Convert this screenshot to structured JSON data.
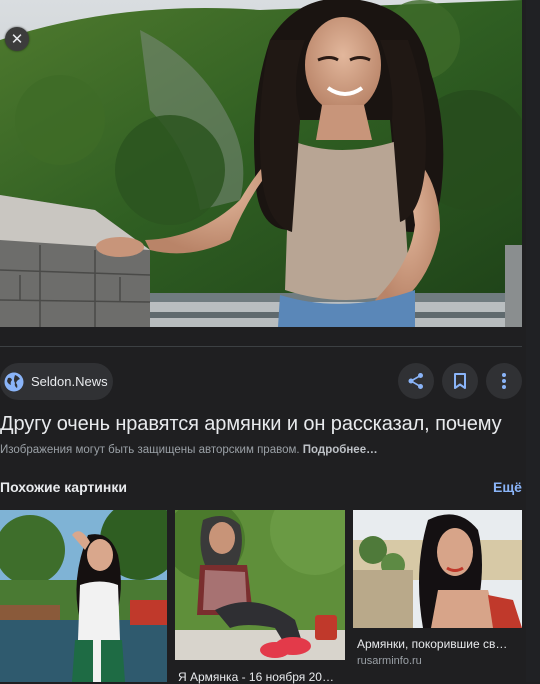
{
  "viewer": {
    "close_symbol": "✕",
    "source": {
      "name": "Seldon.News",
      "icon": "globe-icon"
    },
    "actions": [
      {
        "name": "share",
        "icon": "share-icon"
      },
      {
        "name": "save",
        "icon": "bookmark-icon"
      },
      {
        "name": "more",
        "icon": "more-vert-icon"
      }
    ],
    "title": "Другу очень нравятся армянки и он рассказал, почему",
    "copyright_notice": "Изображения могут быть защищены авторским правом.",
    "details_link": "Подробнее…"
  },
  "similar": {
    "heading": "Похожие картинки",
    "more_label": "Ещё",
    "items": [
      {
        "caption": "",
        "source": ""
      },
      {
        "caption": "Я Армянка - 16 ноября 20…",
        "source": ""
      },
      {
        "caption": "Армянки, покорившие св…",
        "source": "rusarminfo.ru"
      }
    ]
  },
  "colors": {
    "background": "#1f1f21",
    "chip": "#303134",
    "link": "#8ab4f8",
    "icon": "#8ab4f8"
  }
}
